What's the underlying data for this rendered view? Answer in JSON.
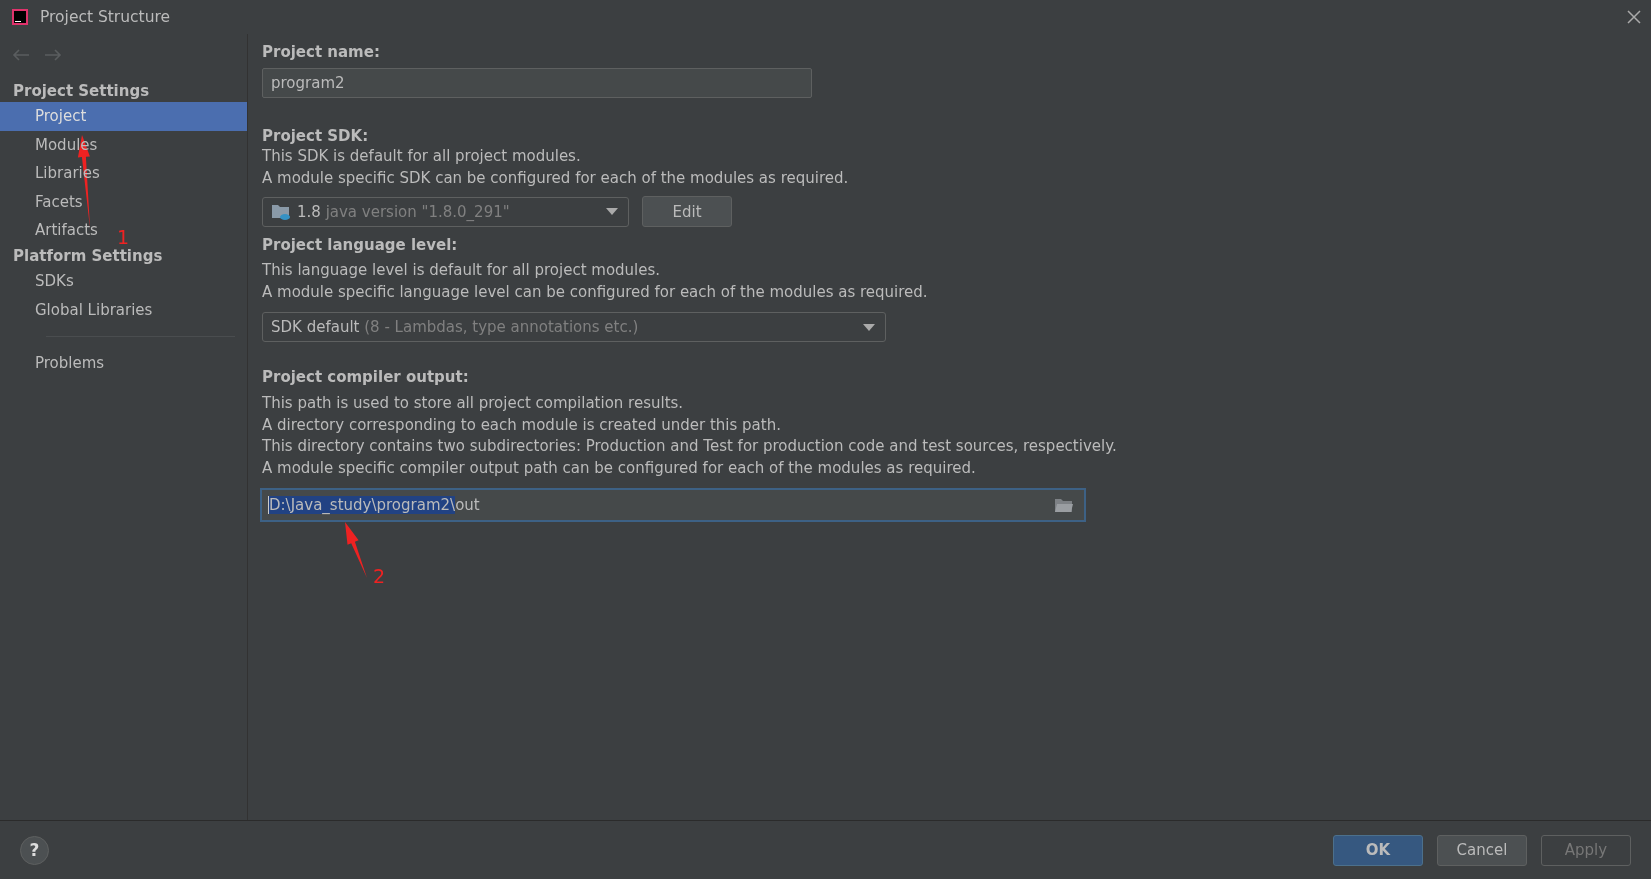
{
  "window": {
    "title": "Project Structure"
  },
  "sidebar": {
    "sections": [
      {
        "heading": "Project Settings",
        "items": [
          {
            "label": "Project",
            "selected": true
          },
          {
            "label": "Modules",
            "selected": false
          },
          {
            "label": "Libraries",
            "selected": false
          },
          {
            "label": "Facets",
            "selected": false
          },
          {
            "label": "Artifacts",
            "selected": false
          }
        ]
      },
      {
        "heading": "Platform Settings",
        "items": [
          {
            "label": "SDKs",
            "selected": false
          },
          {
            "label": "Global Libraries",
            "selected": false
          }
        ]
      }
    ],
    "extra_items": [
      {
        "label": "Problems",
        "selected": false
      }
    ]
  },
  "project_name": {
    "label": "Project name:",
    "value": "program2"
  },
  "project_sdk": {
    "label": "Project SDK:",
    "description": [
      "This SDK is default for all project modules.",
      "A module specific SDK can be configured for each of the modules as required."
    ],
    "dropdown": {
      "value": "1.8",
      "detail": "java version \"1.8.0_291\""
    },
    "edit_button": "Edit"
  },
  "language_level": {
    "label": "Project language level:",
    "description": [
      "This language level is default for all project modules.",
      "A module specific language level can be configured for each of the modules as required."
    ],
    "dropdown": {
      "value": "SDK default",
      "detail": "(8 - Lambdas, type annotations etc.)"
    }
  },
  "compiler_output": {
    "label": "Project compiler output:",
    "description": [
      "This path is used to store all project compilation results.",
      "A directory corresponding to each module is created under this path.",
      "This directory contains two subdirectories: Production and Test for production code and test sources, respectively.",
      "A module specific compiler output path can be configured for each of the modules as required."
    ],
    "path": {
      "selected_text": "D:\\Java_study\\program2\\",
      "rest": "out"
    }
  },
  "annotations": [
    {
      "label": "1"
    },
    {
      "label": "2"
    }
  ],
  "footer": {
    "help": "?",
    "buttons": [
      {
        "label": "OK",
        "kind": "primary"
      },
      {
        "label": "Cancel",
        "kind": "normal"
      },
      {
        "label": "Apply",
        "kind": "disabled"
      }
    ]
  }
}
